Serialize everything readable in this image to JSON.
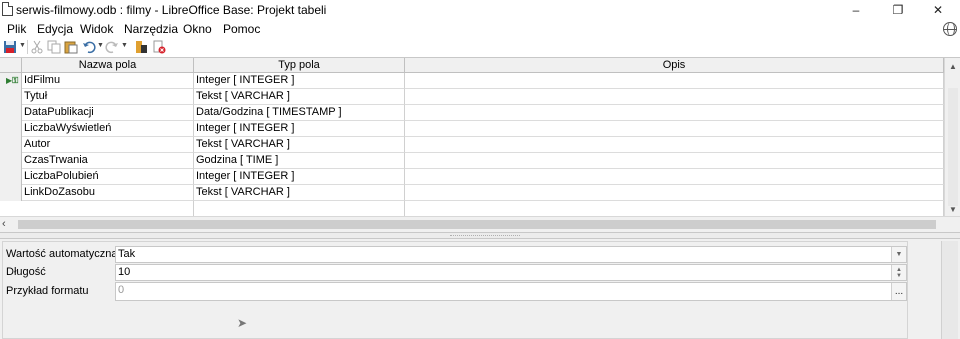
{
  "window": {
    "title": "serwis-filmowy.odb : filmy - LibreOffice Base: Projekt tabeli",
    "controls": {
      "minimize": "–",
      "maximize": "❐",
      "close": "✕"
    }
  },
  "menu": {
    "items": [
      "Plik",
      "Edycja",
      "Widok",
      "Narzędzia",
      "Okno",
      "Pomoc"
    ]
  },
  "toolbar": {
    "icons": [
      "save-icon",
      "cut-icon",
      "copy-icon",
      "paste-icon",
      "undo-icon",
      "redo-icon",
      "index-design-icon",
      "primary-key-icon"
    ]
  },
  "table": {
    "headers": {
      "name": "Nazwa pola",
      "type": "Typ pola",
      "description": "Opis"
    },
    "rows": [
      {
        "name": "IdFilmu",
        "type": "Integer [ INTEGER ]",
        "description": "",
        "primary_key": true
      },
      {
        "name": "Tytuł",
        "type": "Tekst [ VARCHAR ]",
        "description": ""
      },
      {
        "name": "DataPublikacji",
        "type": "Data/Godzina [ TIMESTAMP ]",
        "description": ""
      },
      {
        "name": "LiczbaWyświetleń",
        "type": "Integer [ INTEGER ]",
        "description": ""
      },
      {
        "name": "Autor",
        "type": "Tekst [ VARCHAR ]",
        "description": ""
      },
      {
        "name": "CzasTrwania",
        "type": "Godzina [ TIME ]",
        "description": ""
      },
      {
        "name": "LiczbaPolubień",
        "type": "Integer [ INTEGER ]",
        "description": ""
      },
      {
        "name": "LinkDoZasobu",
        "type": "Tekst [ VARCHAR ]",
        "description": ""
      }
    ]
  },
  "properties": {
    "auto_value": {
      "label": "Wartość automatyczna",
      "value": "Tak"
    },
    "length": {
      "label": "Długość",
      "value": "10"
    },
    "format_example": {
      "label": "Przykład formatu",
      "value": "0",
      "button": "..."
    }
  },
  "colors": {
    "primary_key_marker": "#2e7d32",
    "header_bg": "#f0f0f0",
    "panel_bg": "#f0f0f0"
  }
}
